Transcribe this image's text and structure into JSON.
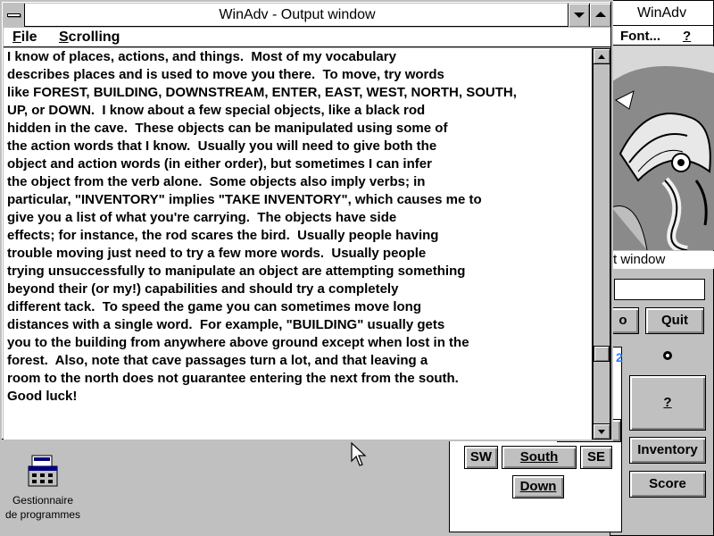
{
  "desktop": {
    "icon_name": "program-manager-icon",
    "icon_label_line1": "Gestionnaire",
    "icon_label_line2": "de programmes"
  },
  "main_window": {
    "title": "WinAdv",
    "menu": [
      {
        "label": "Font..."
      },
      {
        "label": "?"
      }
    ],
    "output_label": "t window",
    "buttons": {
      "quit": "Quit",
      "help": "?",
      "inventory": "Inventory",
      "score": "Score",
      "partial_left": "o",
      "partial_mid": "2"
    },
    "directions": {
      "sw": "SW",
      "south": "South",
      "se": "SE",
      "down": "Down"
    }
  },
  "output_window": {
    "title": "WinAdv - Output window",
    "menu": [
      {
        "accel": "F",
        "rest": "ile"
      },
      {
        "accel": "S",
        "rest": "crolling"
      }
    ],
    "prompt": ">",
    "scroll_position": 0.82,
    "text_lines": [
      "I know of places, actions, and things.  Most of my vocabulary",
      "describes places and is used to move you there.  To move, try words",
      "like FOREST, BUILDING, DOWNSTREAM, ENTER, EAST, WEST, NORTH, SOUTH,",
      "UP, or DOWN.  I know about a few special objects, like a black rod",
      "hidden in the cave.  These objects can be manipulated using some of",
      "the action words that I know.  Usually you will need to give both the",
      "object and action words (in either order), but sometimes I can infer",
      "the object from the verb alone.  Some objects also imply verbs; in",
      "particular, \"INVENTORY\" implies \"TAKE INVENTORY\", which causes me to",
      "give you a list of what you're carrying.  The objects have side",
      "effects; for instance, the rod scares the bird.  Usually people having",
      "trouble moving just need to try a few more words.  Usually people",
      "trying unsuccessfully to manipulate an object are attempting something",
      "beyond their (or my!) capabilities and should try a completely",
      "different tack.  To speed the game you can sometimes move long",
      "distances with a single word.  For example, \"BUILDING\" usually gets",
      "you to the building from anywhere above ground except when lost in the",
      "forest.  Also, note that cave passages turn a lot, and that leaving a",
      "room to the north does not guarantee entering the next from the south.",
      "Good luck!"
    ]
  }
}
